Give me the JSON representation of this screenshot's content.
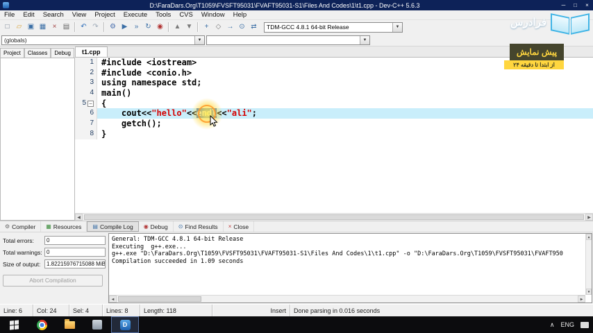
{
  "window": {
    "title": "D:\\FaraDars.Org\\T1059\\FVSFT95031\\FVAFT95031-S1\\Files And Codes\\1\\t1.cpp - Dev-C++ 5.6.3",
    "controls": {
      "minimize": "─",
      "maximize": "□",
      "close": "×"
    }
  },
  "menus": [
    "File",
    "Edit",
    "Search",
    "View",
    "Project",
    "Execute",
    "Tools",
    "CVS",
    "Window",
    "Help"
  ],
  "toolbar": {
    "compiler_profile": "TDM-GCC 4.8.1 64-bit Release",
    "dropdown_arrow": "▼",
    "icons": [
      {
        "name": "new-file",
        "g": "□",
        "c": "#6d7b8d"
      },
      {
        "name": "open-folder",
        "g": "▱",
        "c": "#d9a441"
      },
      {
        "name": "save",
        "g": "▣",
        "c": "#3a6ea5"
      },
      {
        "name": "save-all",
        "g": "▦",
        "c": "#3a6ea5"
      },
      {
        "name": "close-file",
        "g": "×",
        "c": "#a04040"
      },
      {
        "name": "print",
        "g": "▤",
        "c": "#666666"
      },
      {
        "name": "sep"
      },
      {
        "name": "undo",
        "g": "↶",
        "c": "#2b6cb8"
      },
      {
        "name": "redo",
        "g": "↷",
        "c": "#9aa7b5"
      },
      {
        "name": "sep"
      },
      {
        "name": "compile",
        "g": "⚙",
        "c": "#4a6fae"
      },
      {
        "name": "run",
        "g": "▶",
        "c": "#3a6ea5"
      },
      {
        "name": "compile-run",
        "g": "»",
        "c": "#3a6ea5"
      },
      {
        "name": "rebuild",
        "g": "↻",
        "c": "#3a6ea5"
      },
      {
        "name": "debug",
        "g": "◉",
        "c": "#b03030"
      },
      {
        "name": "sep"
      },
      {
        "name": "profile",
        "g": "▲",
        "c": "#7a7a7a"
      },
      {
        "name": "delete-profiling",
        "g": "▼",
        "c": "#7a7a7a"
      },
      {
        "name": "sep"
      },
      {
        "name": "insert",
        "g": "+",
        "c": "#3a6ea5"
      },
      {
        "name": "toggle-bookmark",
        "g": "◇",
        "c": "#7a7a7a"
      },
      {
        "name": "goto-bookmark",
        "g": "→",
        "c": "#3a6ea5"
      },
      {
        "name": "find",
        "g": "⊙",
        "c": "#3a6ea5"
      },
      {
        "name": "replace",
        "g": "⇄",
        "c": "#3a6ea5"
      }
    ]
  },
  "combos": {
    "globals": "(globals)",
    "members": ""
  },
  "brand": {
    "name": "فرادرس"
  },
  "preview": {
    "title": "پیش نمایش",
    "subtitle": "از ابتدا تا دقیقه ۲۴"
  },
  "left_panel": {
    "tabs": [
      "Project",
      "Classes",
      "Debug"
    ]
  },
  "editor": {
    "tab": "t1.cpp",
    "lines": [
      {
        "n": "1",
        "segs": [
          {
            "t": "#include <iostream>",
            "c": "pp"
          }
        ]
      },
      {
        "n": "2",
        "segs": [
          {
            "t": "#include <conio.h>",
            "c": "pp"
          }
        ]
      },
      {
        "n": "3",
        "segs": [
          {
            "t": "using namespace std;",
            "c": "kw"
          }
        ]
      },
      {
        "n": "4",
        "segs": [
          {
            "t": "main()",
            "c": "id"
          }
        ]
      },
      {
        "n": "5",
        "fold": true,
        "segs": [
          {
            "t": "{",
            "c": "id"
          }
        ]
      },
      {
        "n": "6",
        "active": true,
        "segs": [
          {
            "t": "    cout<<",
            "c": "id"
          },
          {
            "t": "\"hello\"",
            "c": "str"
          },
          {
            "t": "<<",
            "c": "id"
          },
          {
            "t": "endl",
            "c": "sel"
          },
          {
            "t": "<<",
            "c": "id"
          },
          {
            "t": "\"ali\"",
            "c": "str"
          },
          {
            "t": ";",
            "c": "id"
          }
        ]
      },
      {
        "n": "7",
        "segs": [
          {
            "t": "    getch();",
            "c": "id"
          }
        ]
      },
      {
        "n": "8",
        "segs": [
          {
            "t": "}",
            "c": "id"
          }
        ]
      }
    ]
  },
  "bottom_tabs": [
    {
      "label": "Compiler",
      "icon": "compiler",
      "g": "⚙",
      "c": "#6b6b6b"
    },
    {
      "label": "Resources",
      "icon": "resources",
      "g": "▦",
      "c": "#3f8f3f"
    },
    {
      "label": "Compile Log",
      "icon": "compile-log",
      "g": "▤",
      "c": "#3a6ea5",
      "active": true
    },
    {
      "label": "Debug",
      "icon": "debug",
      "g": "◉",
      "c": "#b03434"
    },
    {
      "label": "Find Results",
      "icon": "find-results",
      "g": "⊙",
      "c": "#3a6ea5"
    },
    {
      "label": "Close",
      "icon": "close",
      "g": "×",
      "c": "#c03a3a"
    }
  ],
  "compile_log": {
    "stats": [
      {
        "label": "Total errors:",
        "value": "0"
      },
      {
        "label": "Total warnings:",
        "value": "0"
      },
      {
        "label": "Size of output:",
        "value": "1.82215976715088 MiB"
      }
    ],
    "abort_button": "Abort Compilation",
    "lines": [
      "General: TDM-GCC 4.8.1 64-bit Release",
      "Executing  g++.exe...",
      "g++.exe \"D:\\FaraDars.Org\\T1059\\FVSFT95031\\FVAFT95031-S1\\Files And Codes\\1\\t1.cpp\" -o \"D:\\FaraDars.Org\\T1059\\FVSFT95031\\FVAFT950",
      "Compilation succeeded in 1.09 seconds"
    ]
  },
  "statusbar": [
    "Line: 6",
    "Col: 24",
    "Sel: 4",
    "Lines: 8",
    "Length: 118",
    "Insert",
    "Done parsing in 0.016 seconds"
  ],
  "taskbar": {
    "lang": "ENG"
  },
  "colors": {
    "accent_yellow": "#ffd63f",
    "active_line": "#c9eefb",
    "selection_blue": "#2f6fd0",
    "string_red": "#d40000"
  }
}
